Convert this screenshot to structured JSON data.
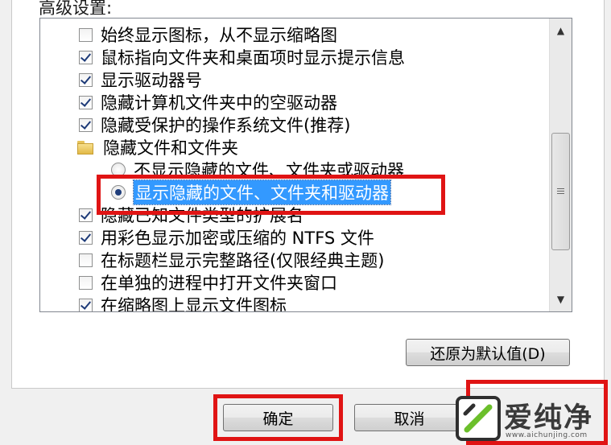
{
  "section_label": "高级设置:",
  "items": [
    {
      "type": "checkbox",
      "checked": false,
      "label": "始终显示图标，从不显示缩略图"
    },
    {
      "type": "checkbox",
      "checked": true,
      "label": "鼠标指向文件夹和桌面项时显示提示信息"
    },
    {
      "type": "checkbox",
      "checked": true,
      "label": "显示驱动器号"
    },
    {
      "type": "checkbox",
      "checked": true,
      "label": "隐藏计算机文件夹中的空驱动器"
    },
    {
      "type": "checkbox",
      "checked": true,
      "label": "隐藏受保护的操作系统文件(推荐)"
    },
    {
      "type": "folder",
      "label": "隐藏文件和文件夹"
    },
    {
      "type": "radio",
      "checked": false,
      "label": "不显示隐藏的文件、文件夹或驱动器"
    },
    {
      "type": "radio",
      "checked": true,
      "label": "显示隐藏的文件、文件夹和驱动器"
    },
    {
      "type": "checkbox",
      "checked": true,
      "label": "隐藏已知文件类型的扩展名"
    },
    {
      "type": "checkbox",
      "checked": true,
      "label": "用彩色显示加密或压缩的 NTFS 文件"
    },
    {
      "type": "checkbox",
      "checked": false,
      "label": "在标题栏显示完整路径(仅限经典主题)"
    },
    {
      "type": "checkbox",
      "checked": false,
      "label": "在单独的进程中打开文件夹窗口"
    },
    {
      "type": "checkbox",
      "checked": true,
      "label": "在缩略图上显示文件图标"
    }
  ],
  "buttons": {
    "restore_defaults": "还原为默认值(D)",
    "ok": "确定",
    "cancel": "取消"
  },
  "watermark": {
    "brand": "爱纯净",
    "url": "www.aichunjing.com"
  },
  "colors": {
    "highlight_red": "#e01414",
    "selection_blue": "#3399ff"
  }
}
